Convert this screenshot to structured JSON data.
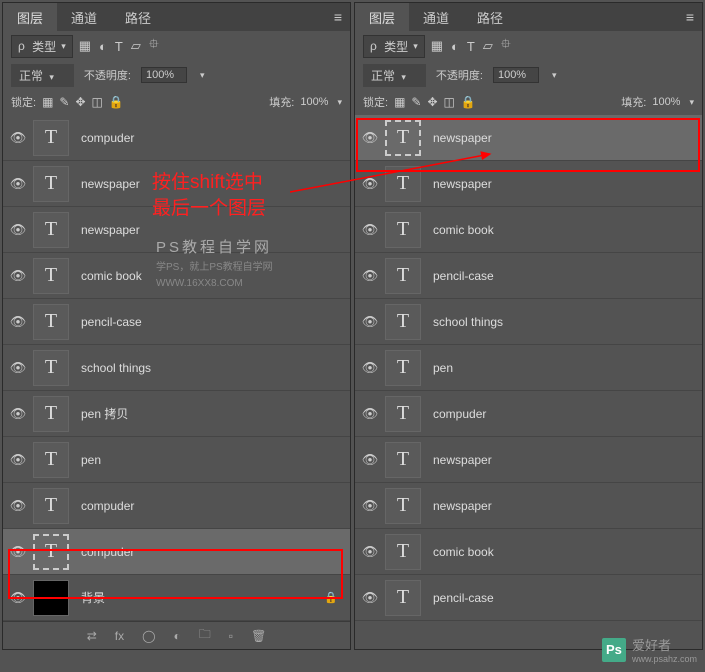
{
  "tabs": {
    "layers": "图层",
    "channels": "通道",
    "paths": "路径"
  },
  "filter": {
    "prefix": "ρ",
    "label": "类型"
  },
  "icons": {
    "search": "🔍",
    "img": "▦",
    "adj": "◐",
    "type": "T",
    "shape": "▱",
    "fx": "⯐"
  },
  "blend": {
    "normal": "正常",
    "opacity_label": "不透明度:",
    "opacity": "100%"
  },
  "lock": {
    "label": "锁定:",
    "img": "▦",
    "brush": "✎",
    "move": "✥",
    "crop": "◫",
    "all": "🔒",
    "fill_label": "填充:",
    "fill": "100%"
  },
  "left_layers": [
    {
      "name": "compuder",
      "sel": false
    },
    {
      "name": "newspaper",
      "sel": false
    },
    {
      "name": "newspaper",
      "sel": false
    },
    {
      "name": "comic book",
      "sel": false
    },
    {
      "name": "pencil-case",
      "sel": false
    },
    {
      "name": "school things",
      "sel": false
    },
    {
      "name": "pen 拷贝",
      "sel": false
    },
    {
      "name": "pen",
      "sel": false
    },
    {
      "name": "compuder",
      "sel": false
    },
    {
      "name": "compuder",
      "sel": true
    }
  ],
  "left_bg": {
    "name": "背景"
  },
  "right_layers": [
    {
      "name": "newspaper",
      "sel": true
    },
    {
      "name": "newspaper",
      "sel": false
    },
    {
      "name": "comic book",
      "sel": false
    },
    {
      "name": "pencil-case",
      "sel": false
    },
    {
      "name": "school things",
      "sel": false
    },
    {
      "name": "pen",
      "sel": false
    },
    {
      "name": "compuder",
      "sel": false
    },
    {
      "name": "newspaper",
      "sel": false
    },
    {
      "name": "newspaper",
      "sel": false
    },
    {
      "name": "comic book",
      "sel": false
    },
    {
      "name": "pencil-case",
      "sel": false
    }
  ],
  "bottom": {
    "link": "⇄",
    "fx": "fx",
    "mask": "◯",
    "adj": "◐",
    "group": "🗀",
    "new": "▫",
    "trash": "🗑"
  },
  "annot": {
    "line1": "按住shift选中",
    "line2": "最后一个图层"
  },
  "wm": {
    "t1": "PS教程自学网",
    "t2": "学PS，就上PS教程自学网",
    "t3": "WWW.16XX8.COM",
    "brand": "爱好者",
    "url": "www.psahz.com",
    "logo": "Ps"
  }
}
